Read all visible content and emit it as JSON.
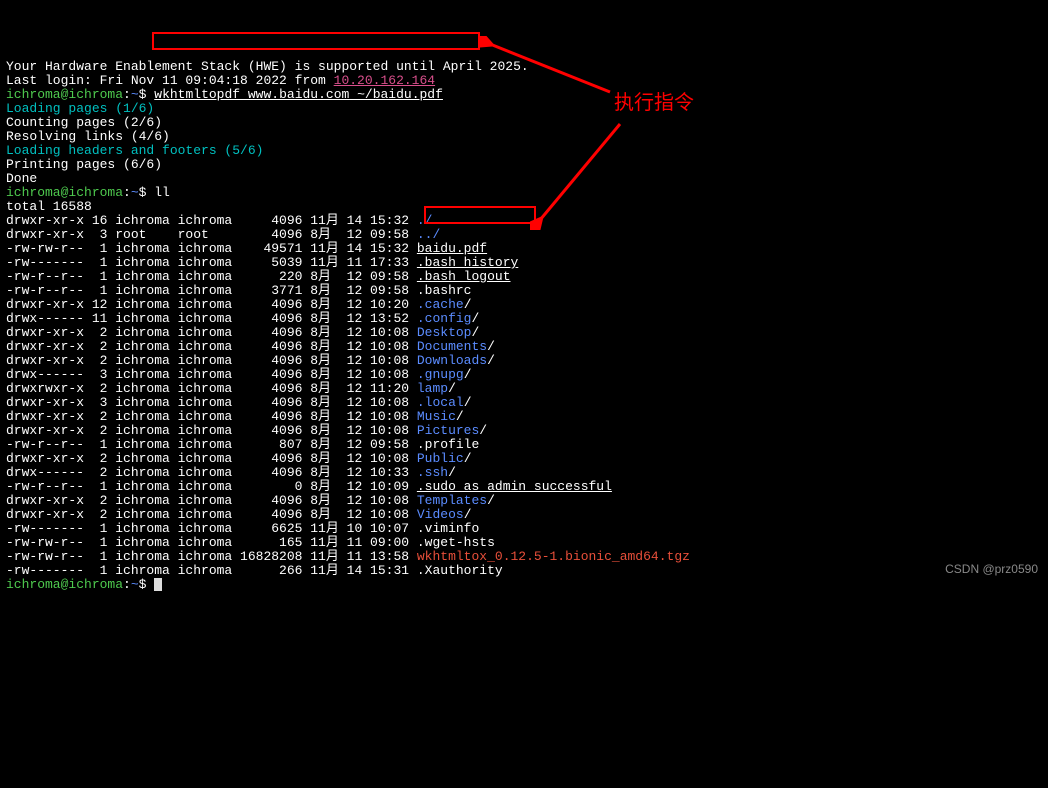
{
  "header": {
    "hwe": "Your Hardware Enablement Stack (HWE) is supported until April 2025.",
    "last_login_prefix": "Last login: Fri Nov 11 09:04:18 2022 from ",
    "last_login_ip": "10.20.162.164"
  },
  "prompt": {
    "user_host": "ichroma@ichroma",
    "colon": ":",
    "path": "~",
    "symbol": "$ "
  },
  "cmd": {
    "first": "wkhtmltopdf www.baidu.com ~/baidu.pdf",
    "second": "ll",
    "third": ""
  },
  "progress": {
    "l1a": "Loading pages (1/6)",
    "l2": "Counting pages (2/6)",
    "l3": "Resolving links (4/6)",
    "l4a": "Loading headers and footers (5/6)",
    "l5": "Printing pages (6/6)",
    "l6": "Done"
  },
  "total": "total 16588",
  "rows": [
    {
      "perm": "drwxr-xr-x",
      "n": "16",
      "own": "ichroma",
      "grp": "ichroma",
      "size": "4096",
      "mon": "11月",
      "day": "14",
      "time": "15:32",
      "name": "./",
      "cls": "blue"
    },
    {
      "perm": "drwxr-xr-x",
      "n": "3",
      "own": "root",
      "grp": "root",
      "size": "4096",
      "mon": "8月",
      "day": "12",
      "time": "09:58",
      "name": "../",
      "cls": "blue"
    },
    {
      "perm": "-rw-rw-r--",
      "n": "1",
      "own": "ichroma",
      "grp": "ichroma",
      "size": "49571",
      "mon": "11月",
      "day": "14",
      "time": "15:32",
      "name": "baidu.pdf",
      "cls": "under"
    },
    {
      "perm": "-rw-------",
      "n": "1",
      "own": "ichroma",
      "grp": "ichroma",
      "size": "5039",
      "mon": "11月",
      "day": "11",
      "time": "17:33",
      "name": ".bash_history",
      "cls": "under"
    },
    {
      "perm": "-rw-r--r--",
      "n": "1",
      "own": "ichroma",
      "grp": "ichroma",
      "size": "220",
      "mon": "8月",
      "day": "12",
      "time": "09:58",
      "name": ".bash_logout",
      "cls": "under"
    },
    {
      "perm": "-rw-r--r--",
      "n": "1",
      "own": "ichroma",
      "grp": "ichroma",
      "size": "3771",
      "mon": "8月",
      "day": "12",
      "time": "09:58",
      "name": ".bashrc",
      "cls": ""
    },
    {
      "perm": "drwxr-xr-x",
      "n": "12",
      "own": "ichroma",
      "grp": "ichroma",
      "size": "4096",
      "mon": "8月",
      "day": "12",
      "time": "10:20",
      "name": ".cache",
      "cls": "blue",
      "suf": "/"
    },
    {
      "perm": "drwx------",
      "n": "11",
      "own": "ichroma",
      "grp": "ichroma",
      "size": "4096",
      "mon": "8月",
      "day": "12",
      "time": "13:52",
      "name": ".config",
      "cls": "blue",
      "suf": "/"
    },
    {
      "perm": "drwxr-xr-x",
      "n": "2",
      "own": "ichroma",
      "grp": "ichroma",
      "size": "4096",
      "mon": "8月",
      "day": "12",
      "time": "10:08",
      "name": "Desktop",
      "cls": "blue",
      "suf": "/"
    },
    {
      "perm": "drwxr-xr-x",
      "n": "2",
      "own": "ichroma",
      "grp": "ichroma",
      "size": "4096",
      "mon": "8月",
      "day": "12",
      "time": "10:08",
      "name": "Documents",
      "cls": "blue",
      "suf": "/"
    },
    {
      "perm": "drwxr-xr-x",
      "n": "2",
      "own": "ichroma",
      "grp": "ichroma",
      "size": "4096",
      "mon": "8月",
      "day": "12",
      "time": "10:08",
      "name": "Downloads",
      "cls": "blue",
      "suf": "/"
    },
    {
      "perm": "drwx------",
      "n": "3",
      "own": "ichroma",
      "grp": "ichroma",
      "size": "4096",
      "mon": "8月",
      "day": "12",
      "time": "10:08",
      "name": ".gnupg",
      "cls": "blue",
      "suf": "/"
    },
    {
      "perm": "drwxrwxr-x",
      "n": "2",
      "own": "ichroma",
      "grp": "ichroma",
      "size": "4096",
      "mon": "8月",
      "day": "12",
      "time": "11:20",
      "name": "lamp",
      "cls": "blue",
      "suf": "/"
    },
    {
      "perm": "drwxr-xr-x",
      "n": "3",
      "own": "ichroma",
      "grp": "ichroma",
      "size": "4096",
      "mon": "8月",
      "day": "12",
      "time": "10:08",
      "name": ".local",
      "cls": "blue",
      "suf": "/"
    },
    {
      "perm": "drwxr-xr-x",
      "n": "2",
      "own": "ichroma",
      "grp": "ichroma",
      "size": "4096",
      "mon": "8月",
      "day": "12",
      "time": "10:08",
      "name": "Music",
      "cls": "blue",
      "suf": "/"
    },
    {
      "perm": "drwxr-xr-x",
      "n": "2",
      "own": "ichroma",
      "grp": "ichroma",
      "size": "4096",
      "mon": "8月",
      "day": "12",
      "time": "10:08",
      "name": "Pictures",
      "cls": "blue",
      "suf": "/"
    },
    {
      "perm": "-rw-r--r--",
      "n": "1",
      "own": "ichroma",
      "grp": "ichroma",
      "size": "807",
      "mon": "8月",
      "day": "12",
      "time": "09:58",
      "name": ".profile",
      "cls": ""
    },
    {
      "perm": "drwxr-xr-x",
      "n": "2",
      "own": "ichroma",
      "grp": "ichroma",
      "size": "4096",
      "mon": "8月",
      "day": "12",
      "time": "10:08",
      "name": "Public",
      "cls": "blue",
      "suf": "/"
    },
    {
      "perm": "drwx------",
      "n": "2",
      "own": "ichroma",
      "grp": "ichroma",
      "size": "4096",
      "mon": "8月",
      "day": "12",
      "time": "10:33",
      "name": ".ssh",
      "cls": "blue",
      "suf": "/"
    },
    {
      "perm": "-rw-r--r--",
      "n": "1",
      "own": "ichroma",
      "grp": "ichroma",
      "size": "0",
      "mon": "8月",
      "day": "12",
      "time": "10:09",
      "name": ".sudo_as_admin_successful",
      "cls": "under"
    },
    {
      "perm": "drwxr-xr-x",
      "n": "2",
      "own": "ichroma",
      "grp": "ichroma",
      "size": "4096",
      "mon": "8月",
      "day": "12",
      "time": "10:08",
      "name": "Templates",
      "cls": "blue",
      "suf": "/"
    },
    {
      "perm": "drwxr-xr-x",
      "n": "2",
      "own": "ichroma",
      "grp": "ichroma",
      "size": "4096",
      "mon": "8月",
      "day": "12",
      "time": "10:08",
      "name": "Videos",
      "cls": "blue",
      "suf": "/"
    },
    {
      "perm": "-rw-------",
      "n": "1",
      "own": "ichroma",
      "grp": "ichroma",
      "size": "6625",
      "mon": "11月",
      "day": "10",
      "time": "10:07",
      "name": ".viminfo",
      "cls": ""
    },
    {
      "perm": "-rw-rw-r--",
      "n": "1",
      "own": "ichroma",
      "grp": "ichroma",
      "size": "165",
      "mon": "11月",
      "day": "11",
      "time": "09:00",
      "name": ".wget-hsts",
      "cls": ""
    },
    {
      "perm": "-rw-rw-r--",
      "n": "1",
      "own": "ichroma",
      "grp": "ichroma",
      "size": "16828208",
      "mon": "11月",
      "day": "11",
      "time": "13:58",
      "name": "wkhtmltox_0.12.5-1.bionic_amd64.tgz",
      "cls": "red"
    },
    {
      "perm": "-rw-------",
      "n": "1",
      "own": "ichroma",
      "grp": "ichroma",
      "size": "266",
      "mon": "11月",
      "day": "14",
      "time": "15:31",
      "name": ".Xauthority",
      "cls": ""
    }
  ],
  "annotation": {
    "label": "执行指令"
  },
  "watermark": "CSDN @prz0590"
}
